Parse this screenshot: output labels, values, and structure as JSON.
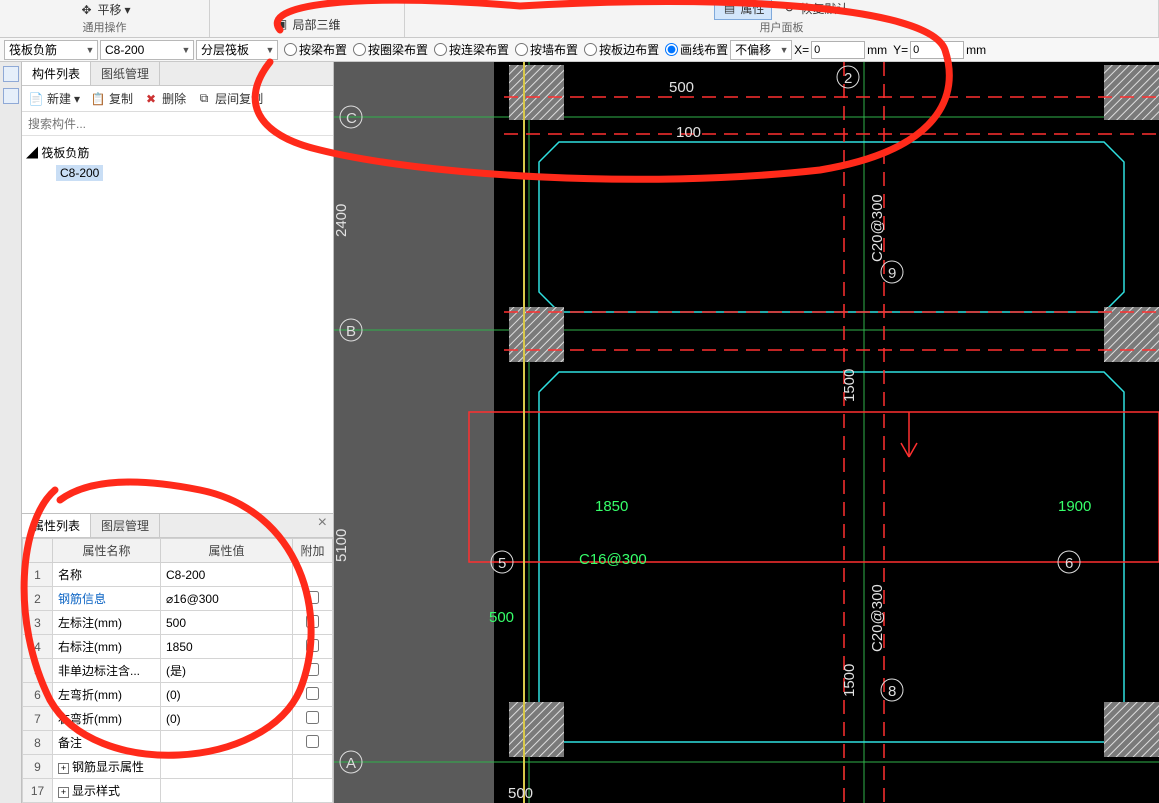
{
  "ribbon": {
    "group1_label": "通用操作",
    "group2_label": "",
    "group3_label": "用户面板",
    "pan": "平移",
    "local3d": "局部三维",
    "props": "属性",
    "restore": "恢复默认"
  },
  "tbar2": {
    "combo1": "筏板负筋",
    "combo2": "C8-200",
    "combo3": "分层筏板",
    "r1": "按梁布置",
    "r2": "按圈梁布置",
    "r3": "按连梁布置",
    "r4": "按墙布置",
    "r5": "按板边布置",
    "r6": "画线布置",
    "offset_combo": "不偏移",
    "xlabel": "X=",
    "xval": "0",
    "xunit": "mm",
    "ylabel": "Y=",
    "yval": "0",
    "yunit": "mm"
  },
  "leftTop": {
    "tab1": "构件列表",
    "tab2": "图纸管理",
    "new": "新建",
    "copy": "复制",
    "delete": "删除",
    "layerCopy": "层间复制",
    "search_ph": "搜索构件...",
    "tree_parent": "筏板负筋",
    "tree_child": "C8-200"
  },
  "prop": {
    "tab1": "属性列表",
    "tab2": "图层管理",
    "col_name": "属性名称",
    "col_val": "属性值",
    "col_add": "附加",
    "rows": [
      {
        "n": "1",
        "name": "名称",
        "val": "C8-200",
        "chk": ""
      },
      {
        "n": "2",
        "name": "钢筋信息",
        "val": "⌀16@300",
        "chk": "☐",
        "link": true
      },
      {
        "n": "3",
        "name": "左标注(mm)",
        "val": "500",
        "chk": "☐"
      },
      {
        "n": "4",
        "name": "右标注(mm)",
        "val": "1850",
        "chk": "☐"
      },
      {
        "n": "5",
        "name": "非单边标注含...",
        "val": "(是)",
        "chk": "☐"
      },
      {
        "n": "6",
        "name": "左弯折(mm)",
        "val": "(0)",
        "chk": "☐"
      },
      {
        "n": "7",
        "name": "右弯折(mm)",
        "val": "(0)",
        "chk": "☐"
      },
      {
        "n": "8",
        "name": "备注",
        "val": "",
        "chk": "☐"
      },
      {
        "n": "9",
        "name": "钢筋显示属性",
        "val": "",
        "expand": true
      },
      {
        "n": "17",
        "name": "显示样式",
        "val": "",
        "expand": true
      }
    ]
  },
  "canvas": {
    "dim_500a": "500",
    "dim_100": "100",
    "dim_2400": "2400",
    "dim_5100": "5100",
    "dim_1850": "1850",
    "dim_1900": "1900",
    "dim_500b": "500",
    "dim_500c": "500",
    "dim_1500a": "1500",
    "dim_1500b": "1500",
    "txt_c16": "C16@300",
    "txt_c20a": "C20@300",
    "txt_c20b": "C20@300",
    "grid_A": "A",
    "grid_B": "B",
    "grid_C": "C",
    "b2": "2",
    "b5": "5",
    "b6": "6",
    "b8": "8",
    "b9": "9"
  }
}
